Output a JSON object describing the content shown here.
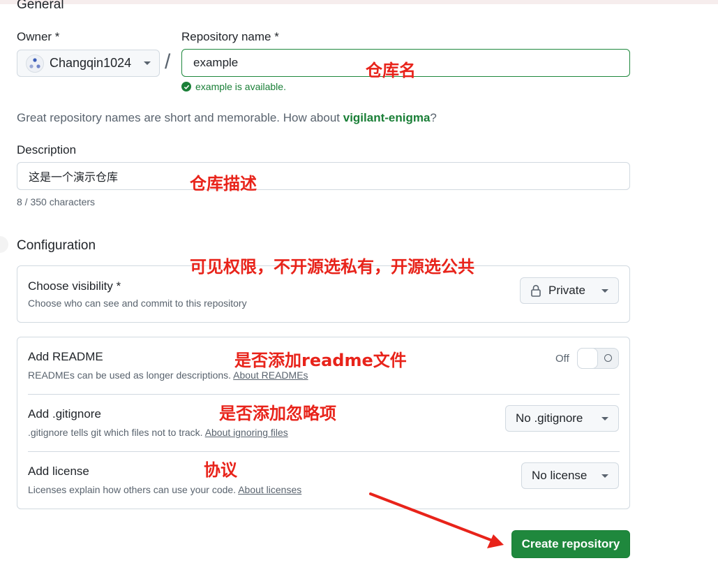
{
  "general": {
    "title": "General",
    "owner_label": "Owner *",
    "owner_value": "Changqin1024",
    "repo_label": "Repository name *",
    "repo_value": "example",
    "separator": "/",
    "availability": "example is available.",
    "hint_prefix": "Great repository names are short and memorable. How about ",
    "hint_suggestion": "vigilant-enigma",
    "hint_suffix": "?",
    "description_label": "Description",
    "description_value": "这是一个演示仓库",
    "char_count": "8 / 350 characters"
  },
  "configuration": {
    "title": "Configuration",
    "visibility": {
      "title": "Choose visibility *",
      "subtitle": "Choose who can see and commit to this repository",
      "value": "Private"
    },
    "readme": {
      "title": "Add README",
      "subtitle": "READMEs can be used as longer descriptions.",
      "link": "About READMEs",
      "toggle_label": "Off"
    },
    "gitignore": {
      "title": "Add .gitignore",
      "subtitle": ".gitignore tells git which files not to track.",
      "link": "About ignoring files",
      "value": "No .gitignore"
    },
    "license": {
      "title": "Add license",
      "subtitle": "Licenses explain how others can use your code.",
      "link": "About licenses",
      "value": "No license"
    }
  },
  "create_button": "Create repository",
  "annotations": {
    "repo_name": "仓库名",
    "repo_desc": "仓库描述",
    "visibility": "可见权限，不开源选私有，开源选公共",
    "readme": "是否添加readme文件",
    "gitignore": "是否添加忽略项",
    "license": "协议"
  },
  "icons": {
    "owner_avatar": "identicon-avatar",
    "owner_caret": "caret-down-icon",
    "available": "check-circle-icon",
    "visibility": "lock-icon",
    "arrow": "red-arrow-annotation"
  },
  "colors": {
    "accent_green": "#1f883d",
    "success_text": "#1a7f37",
    "annotation_red": "#e8231a",
    "muted_text": "#59636e",
    "border": "#d1d9e0"
  }
}
